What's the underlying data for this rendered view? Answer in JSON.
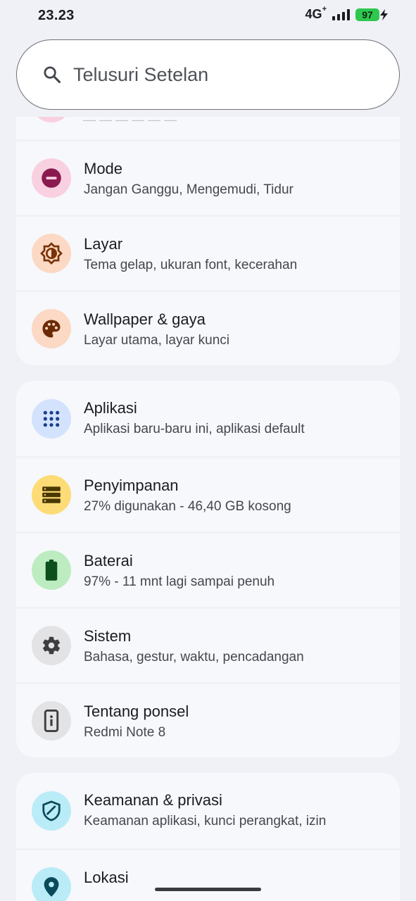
{
  "status_bar": {
    "time": "23.23",
    "network": "4G",
    "network_plus": "+",
    "battery_level": "97",
    "battery_color": "#2ec84e"
  },
  "search": {
    "placeholder": "Telusuri Setelan",
    "icon": "search-icon"
  },
  "groups": [
    {
      "items": [
        {
          "title": "Mode",
          "subtitle": "Jangan Ganggu, Mengemudi, Tidur",
          "icon": "do-not-disturb-icon",
          "icon_bg": "#f8d0e0",
          "icon_color": "#8a1a4e"
        },
        {
          "title": "Layar",
          "subtitle": "Tema gelap, ukuran font, kecerahan",
          "icon": "brightness-icon",
          "icon_bg": "#fbd9c4",
          "icon_color": "#7a3206"
        },
        {
          "title": "Wallpaper & gaya",
          "subtitle": "Layar utama, layar kunci",
          "icon": "palette-icon",
          "icon_bg": "#fbd9c4",
          "icon_color": "#6b2a05"
        }
      ]
    },
    {
      "items": [
        {
          "title": "Aplikasi",
          "subtitle": "Aplikasi baru-baru ini, aplikasi default",
          "icon": "apps-grid-icon",
          "icon_bg": "#d3e3fd",
          "icon_color": "#1b3f8a"
        },
        {
          "title": "Penyimpanan",
          "subtitle": "27% digunakan - 46,40 GB kosong",
          "icon": "storage-icon",
          "icon_bg": "#fddc77",
          "icon_color": "#4a3800"
        },
        {
          "title": "Baterai",
          "subtitle": "97% - 11 mnt lagi sampai penuh",
          "icon": "battery-icon",
          "icon_bg": "#bdecc1",
          "icon_color": "#0d4f1c"
        },
        {
          "title": "Sistem",
          "subtitle": "Bahasa, gestur, waktu, pencadangan",
          "icon": "gear-icon",
          "icon_bg": "#e3e3e6",
          "icon_color": "#3d3e42"
        },
        {
          "title": "Tentang ponsel",
          "subtitle": "Redmi Note 8",
          "icon": "phone-info-icon",
          "icon_bg": "#e3e3e6",
          "icon_color": "#3d3e42"
        }
      ]
    },
    {
      "items": [
        {
          "title": "Keamanan & privasi",
          "subtitle": "Keamanan aplikasi, kunci perangkat, izin",
          "icon": "shield-icon",
          "icon_bg": "#b9ecf7",
          "icon_color": "#0b4a58"
        },
        {
          "title": "Lokasi",
          "subtitle": "",
          "icon": "location-pin-icon",
          "icon_bg": "#b9ecf7",
          "icon_color": "#0b4a58"
        }
      ]
    }
  ]
}
